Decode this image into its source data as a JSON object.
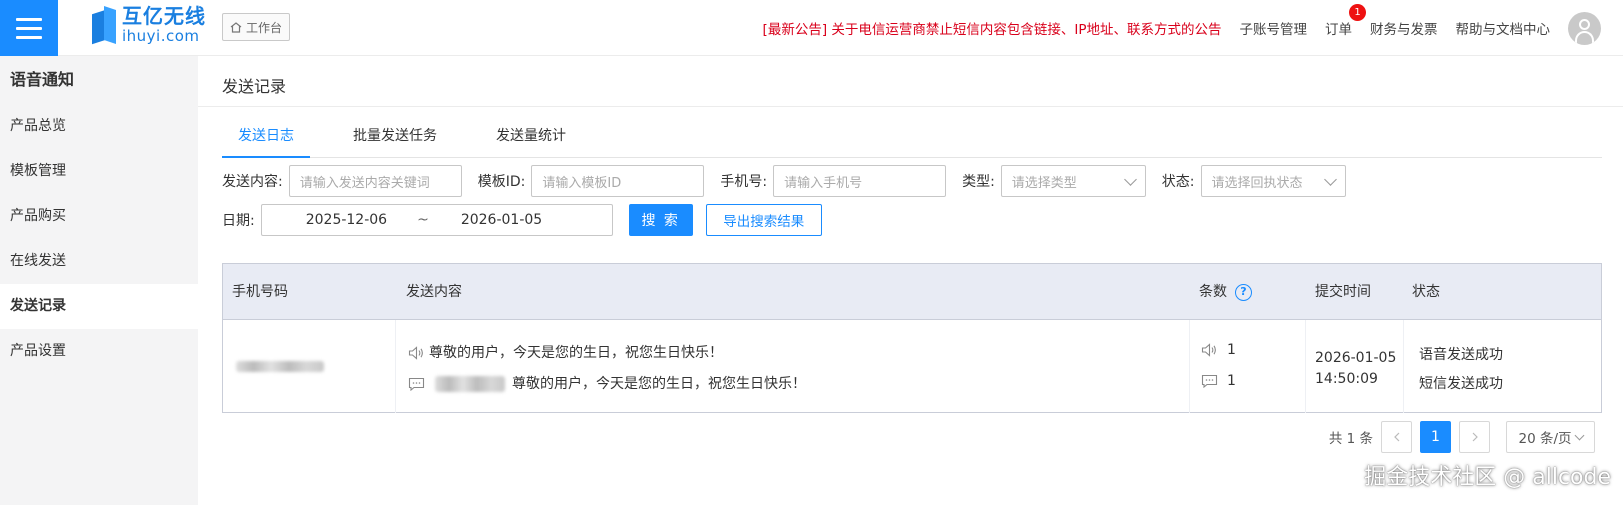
{
  "header": {
    "logo_cn": "互亿无线",
    "logo_en": "ihuyi.com",
    "workbench": "工作台",
    "notice": "[最新公告] 关于电信运营商禁止短信内容包含链接、IP地址、联系方式的公告",
    "links": [
      "子账号管理",
      "订单",
      "财务与发票",
      "帮助与文档中心"
    ],
    "order_badge": "1"
  },
  "sidebar": {
    "title": "语音通知",
    "items": [
      {
        "label": "产品总览"
      },
      {
        "label": "模板管理"
      },
      {
        "label": "产品购买"
      },
      {
        "label": "在线发送"
      },
      {
        "label": "发送记录",
        "active": true
      },
      {
        "label": "产品设置"
      }
    ]
  },
  "main": {
    "title": "发送记录",
    "tabs": [
      "发送日志",
      "批量发送任务",
      "发送量统计"
    ],
    "filters": {
      "content_label": "发送内容:",
      "content_placeholder": "请输入发送内容关键词",
      "template_label": "模板ID:",
      "template_placeholder": "请输入模板ID",
      "phone_label": "手机号:",
      "phone_placeholder": "请输入手机号",
      "type_label": "类型:",
      "type_placeholder": "请选择类型",
      "status_label": "状态:",
      "status_placeholder": "请选择回执状态",
      "date_label": "日期:",
      "date_start": "2025-12-06",
      "date_sep": "~",
      "date_end": "2026-01-05",
      "search_button": "搜 索",
      "export_button": "导出搜索结果"
    },
    "table": {
      "headers": {
        "phone": "手机号码",
        "content": "发送内容",
        "count": "条数",
        "time": "提交时间",
        "status": "状态"
      },
      "rows": [
        {
          "voice_content": "尊敬的用户，今天是您的生日，祝您生日快乐！",
          "sms_content": "尊敬的用户，今天是您的生日，祝您生日快乐！",
          "voice_count": "1",
          "sms_count": "1",
          "date": "2026-01-05",
          "time": "14:50:09",
          "voice_status": "语音发送成功",
          "sms_status": "短信发送成功"
        }
      ]
    },
    "pagination": {
      "total": "共 1 条",
      "current": "1",
      "page_size": "20 条/页"
    }
  },
  "watermark": "掘金技术社区 @ allcode",
  "colors": {
    "primary": "#1a8cff",
    "notice": "#d9001b",
    "sidebar_bg": "#f4f4f5",
    "table_header_bg": "#e8ebf4"
  }
}
